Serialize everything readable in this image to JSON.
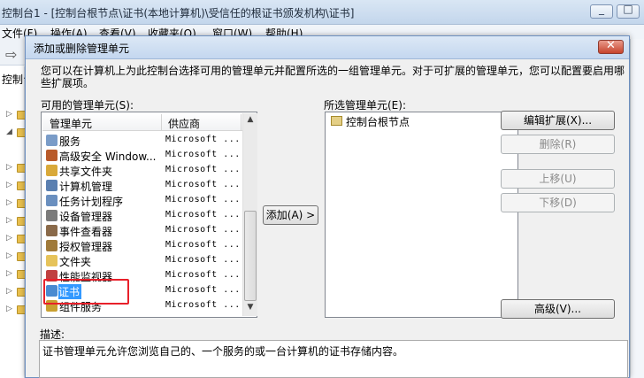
{
  "main_window": {
    "title": "控制台1 - [控制台根节点\\证书(本地计算机)\\受信任的根证书颁发机构\\证书]",
    "menu": [
      "文件(F)",
      "操作(A)",
      "查看(V)",
      "收藏夹(O)",
      "窗口(W)",
      "帮助(H)"
    ],
    "tree_label": "控制台"
  },
  "dialog": {
    "title": "添加或删除管理单元",
    "intro": "您可以在计算机上为此控制台选择可用的管理单元并配置所选的一组管理单元。对于可扩展的管理单元，您可以配置要启用哪些扩展项。",
    "available_label": "可用的管理单元(S):",
    "columns": {
      "snapin": "管理单元",
      "vendor": "供应商"
    },
    "snapins": [
      {
        "name": "服务",
        "vendor": "Microsoft ...",
        "icon": "gear-icon",
        "color": "#7a9cc8"
      },
      {
        "name": "高级安全 Window...",
        "vendor": "Microsoft ...",
        "icon": "firewall-icon",
        "color": "#b85a2a"
      },
      {
        "name": "共享文件夹",
        "vendor": "Microsoft ...",
        "icon": "shared-folder-icon",
        "color": "#d9a93a"
      },
      {
        "name": "计算机管理",
        "vendor": "Microsoft ...",
        "icon": "computer-icon",
        "color": "#5a7fb0"
      },
      {
        "name": "任务计划程序",
        "vendor": "Microsoft ...",
        "icon": "clock-icon",
        "color": "#6a8fbf"
      },
      {
        "name": "设备管理器",
        "vendor": "Microsoft ...",
        "icon": "device-icon",
        "color": "#7b7b7b"
      },
      {
        "name": "事件查看器",
        "vendor": "Microsoft ...",
        "icon": "event-log-icon",
        "color": "#8a6a4a"
      },
      {
        "name": "授权管理器",
        "vendor": "Microsoft ...",
        "icon": "authorization-icon",
        "color": "#a07a3a"
      },
      {
        "name": "文件夹",
        "vendor": "Microsoft ...",
        "icon": "folder-icon",
        "color": "#e6c35a"
      },
      {
        "name": "性能监视器",
        "vendor": "Microsoft ...",
        "icon": "performance-icon",
        "color": "#c04040"
      },
      {
        "name": "证书",
        "vendor": "Microsoft ...",
        "icon": "certificate-icon",
        "color": "#4a8ad0"
      },
      {
        "name": "组件服务",
        "vendor": "Microsoft ...",
        "icon": "component-icon",
        "color": "#c9a030"
      }
    ],
    "selected_snapin": "证书",
    "add_button": "添加(A) >",
    "selected_label": "所选管理单元(E):",
    "selected_items": [
      "控制台根节点"
    ],
    "buttons": {
      "edit_extensions": "编辑扩展(X)...",
      "remove": "删除(R)",
      "move_up": "上移(U)",
      "move_down": "下移(D)",
      "advanced": "高级(V)..."
    },
    "description_label": "描述:",
    "description": "证书管理单元允许您浏览自己的、一个服务的或一台计算机的证书存储内容。"
  }
}
